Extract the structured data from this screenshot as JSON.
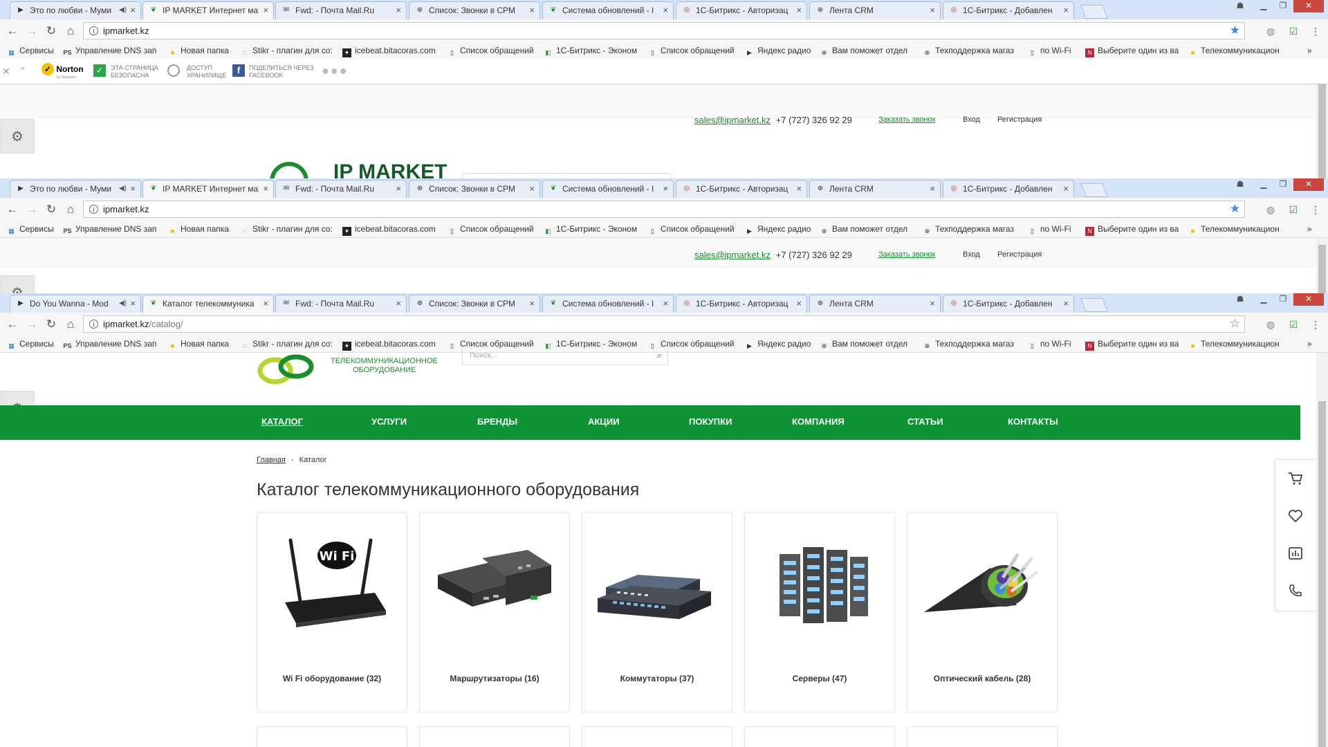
{
  "browser": {
    "windows": [
      {
        "tabs": [
          {
            "title": "Это по любви - Муми",
            "icon": "play-icon",
            "audio": true,
            "active": false
          },
          {
            "title": "IP MARKET Интернет ма",
            "icon": "leaf-icon",
            "active": true
          },
          {
            "title": "Fwd: - Почта Mail.Ru",
            "icon": "mail-icon",
            "active": false
          },
          {
            "title": "Список: Звонки в CPM",
            "icon": "crm-icon",
            "active": false
          },
          {
            "title": "Система обновлений - I",
            "icon": "leaf-icon",
            "active": false
          },
          {
            "title": "1С-Битрикс - Авторизац",
            "icon": "bitrix-icon",
            "active": false
          },
          {
            "title": "Лента CRM",
            "icon": "crm-icon",
            "active": false
          },
          {
            "title": "1С-Битрикс - Добавлен",
            "icon": "bitrix-icon",
            "active": false
          }
        ],
        "url": "ipmarket.kz",
        "url_path": ""
      },
      {
        "tabs": [
          {
            "title": "Это по любви - Муми",
            "icon": "play-icon",
            "audio": true,
            "active": false
          },
          {
            "title": "IP MARKET Интернет ма",
            "icon": "leaf-icon",
            "active": true
          },
          {
            "title": "Fwd: - Почта Mail.Ru",
            "icon": "mail-icon",
            "active": false
          },
          {
            "title": "Список: Звонки в CPM",
            "icon": "crm-icon",
            "active": false
          },
          {
            "title": "Система обновлений - I",
            "icon": "leaf-icon",
            "active": false
          },
          {
            "title": "1С-Битрикс - Авторизац",
            "icon": "bitrix-icon",
            "active": false
          },
          {
            "title": "Лента CRM",
            "icon": "crm-icon",
            "active": false
          },
          {
            "title": "1С-Битрикс - Добавлен",
            "icon": "bitrix-icon",
            "active": false
          }
        ],
        "url": "ipmarket.kz",
        "url_path": ""
      },
      {
        "tabs": [
          {
            "title": "Do You Wanna - Mod",
            "icon": "play-icon",
            "audio": true,
            "active": false
          },
          {
            "title": "Каталог телекоммуника",
            "icon": "leaf-icon",
            "active": true
          },
          {
            "title": "Fwd: - Почта Mail.Ru",
            "icon": "mail-icon",
            "active": false
          },
          {
            "title": "Список: Звонки в CPM",
            "icon": "crm-icon",
            "active": false
          },
          {
            "title": "Система обновлений - I",
            "icon": "leaf-icon",
            "active": false
          },
          {
            "title": "1С-Битрикс - Авторизац",
            "icon": "bitrix-icon",
            "active": false
          },
          {
            "title": "Лента CRM",
            "icon": "crm-icon",
            "active": false
          },
          {
            "title": "1С-Битрикс - Добавлен",
            "icon": "bitrix-icon",
            "active": false
          }
        ],
        "url": "ipmarket.kz",
        "url_path": "/catalog/"
      }
    ],
    "bookmarks": [
      {
        "label": "Сервисы",
        "icon": "apps-icon"
      },
      {
        "label": "Управление DNS зап",
        "icon": "ps-icon"
      },
      {
        "label": "Новая папка",
        "icon": "folder-icon"
      },
      {
        "label": "Stikr - плагин для co:",
        "icon": "stikr-icon"
      },
      {
        "label": "icebeat.bitacoras.com",
        "icon": "icebeat-icon"
      },
      {
        "label": "Список обращений",
        "icon": "page-icon"
      },
      {
        "label": "1С-Битрикс - Эконом",
        "icon": "bitrix-icon"
      },
      {
        "label": "Список обращений",
        "icon": "page-icon"
      },
      {
        "label": "Яндекс радио",
        "icon": "play-icon"
      },
      {
        "label": "Вам поможет отдел р",
        "icon": "crm-icon"
      },
      {
        "label": "Техподдержка магаз",
        "icon": "crm-icon"
      },
      {
        "label": "по Wi-Fi",
        "icon": "page-icon"
      },
      {
        "label": "Выберите один из ва",
        "icon": "n-icon"
      },
      {
        "label": "Телекоммуникацион",
        "icon": "folder-icon"
      }
    ],
    "norton": {
      "brand": "Norton",
      "brand_sub": "by Symantec",
      "safe_line1": "ЭТА СТРАНИЦА",
      "safe_line2": "БЕЗОПАСНА",
      "vault_line1": "ДОСТУП",
      "vault_line2": "ХРАНИЛИЩЕ",
      "share_line1": "ПОДЕЛИТЬСЯ ЧЕРЕЗ",
      "share_line2": "FACEBOOK"
    }
  },
  "site": {
    "email": "sales@ipmarket.kz",
    "phone": "+7 (727) 326 92 29",
    "callback": "Заказать звонок",
    "login": "Вход",
    "register": "Регистрация",
    "logo_text": "IP MARKET",
    "logo_sub_1": "ТЕЛЕКОММУНИКАЦИОННОЕ",
    "logo_sub_2": "ОБОРУДОВАНИЕ",
    "search_placeholder": "Поиск...",
    "nav": [
      "КАТАЛОГ",
      "УСЛУГИ",
      "БРЕНДЫ",
      "АКЦИИ",
      "ПОКУПКИ",
      "КОМПАНИЯ",
      "СТАТЬИ",
      "КОНТАКТЫ"
    ],
    "breadcrumb_home": "Главная",
    "breadcrumb_sep": "-",
    "breadcrumb_current": "Каталог",
    "page_title": "Каталог телекоммуникационного оборудования",
    "categories": [
      {
        "name": "Wi Fi оборудование (32)",
        "image": "wifi-router"
      },
      {
        "name": "Маршрутизаторы (16)",
        "image": "routers"
      },
      {
        "name": "Коммутаторы (37)",
        "image": "switches"
      },
      {
        "name": "Серверы (47)",
        "image": "servers"
      },
      {
        "name": "Оптический кабель (28)",
        "image": "fiber-cable"
      }
    ],
    "side_icons": [
      "cart-icon",
      "heart-icon",
      "compare-icon",
      "phone-icon"
    ],
    "accent_color": "#0d9334"
  }
}
